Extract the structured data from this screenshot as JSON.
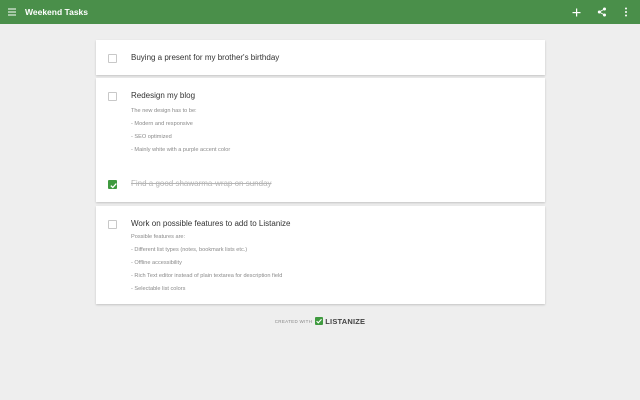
{
  "app": {
    "title": "Weekend Tasks"
  },
  "toolbar": {
    "icons": [
      "menu-icon",
      "add-icon",
      "share-icon",
      "more-vert-icon"
    ]
  },
  "tasks": [
    {
      "title": "Buying a present for my brother's birthday",
      "done": false,
      "description": []
    },
    {
      "title": "Redesign my blog",
      "done": false,
      "description": [
        "The new design has to be:",
        "- Modern and responsive",
        "- SEO optimized",
        "- Mainly white with a purple accent color"
      ]
    },
    {
      "title": "Find a good shawarma-wrap on sunday",
      "done": true,
      "description": []
    },
    {
      "title": "Work on possible features to add to Listanize",
      "done": false,
      "description": [
        "Possible features are:",
        "- Different list types (notes, bookmark lists etc.)",
        "- Offline accessibility",
        "- Rich Text editor instead of plain textarea for description field",
        "- Selectable list colors"
      ]
    }
  ],
  "footer": {
    "created_with": "CREATED WITH",
    "brand": "LISTANIZE"
  },
  "colors": {
    "appbar": "#4a8f4a",
    "check": "#3f9a3f",
    "background": "#eeeeee"
  }
}
